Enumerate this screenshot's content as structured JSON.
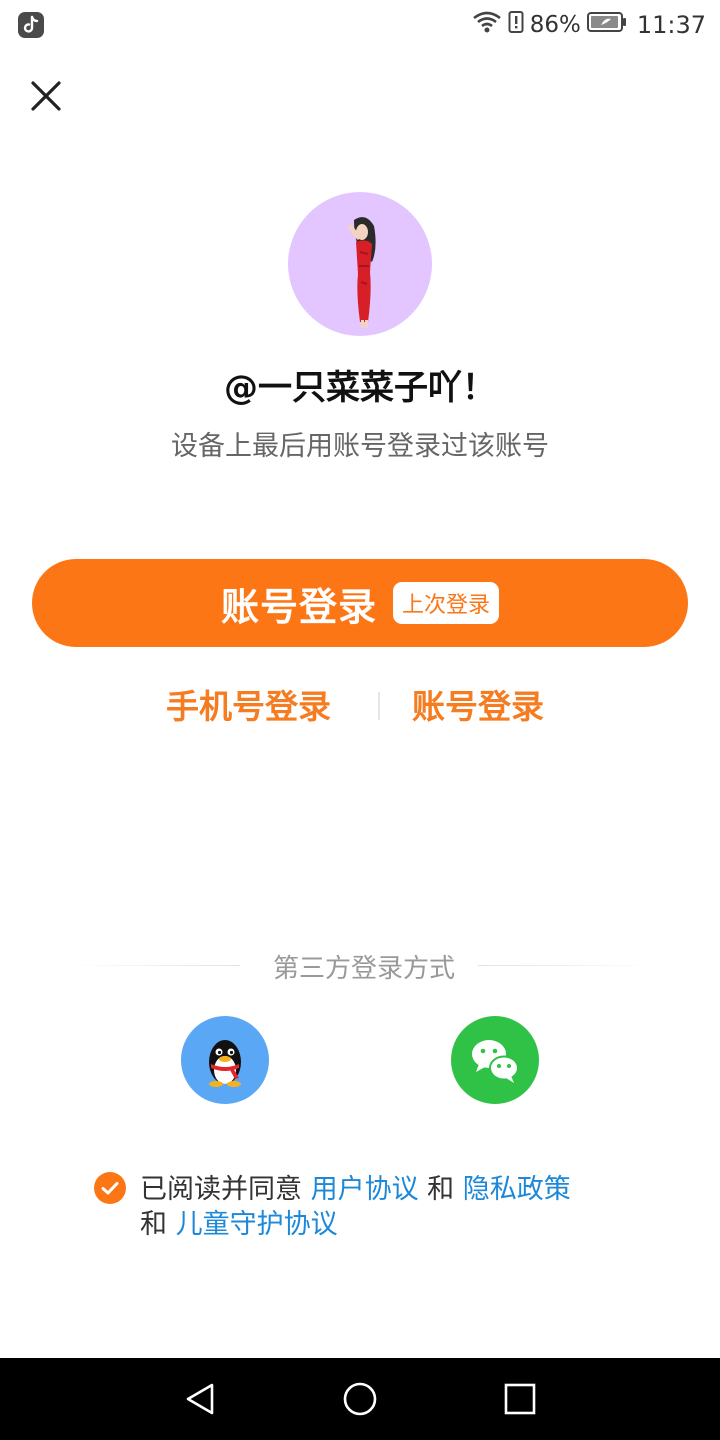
{
  "status_bar": {
    "battery_percent": "86%",
    "time": "11:37",
    "icons": [
      "tiktok-app-icon",
      "wifi-icon",
      "alert-icon",
      "battery-icon"
    ]
  },
  "profile": {
    "username": "@一只菜菜子吖！",
    "subtitle": "设备上最后用账号登录过该账号"
  },
  "primary_login": {
    "label": "账号登录",
    "badge": "上次登录",
    "color": "#fd7615"
  },
  "alt_login": {
    "phone_label": "手机号登录",
    "account_label": "账号登录",
    "color": "#f57c20"
  },
  "third_party": {
    "title": "第三方登录方式",
    "providers": [
      {
        "name": "qq",
        "icon": "qq-penguin-icon",
        "color": "#5aa7f5"
      },
      {
        "name": "wechat",
        "icon": "wechat-icon",
        "color": "#2fc246"
      }
    ]
  },
  "agreement": {
    "checked": true,
    "prefix": "已阅读并同意 ",
    "link_user": "用户协议",
    "and1": " 和 ",
    "link_privacy": "隐私政策",
    "and2": " 和 ",
    "link_children": "儿童守护协议",
    "link_color": "#1e88d8"
  },
  "nav_bar": {
    "icons": [
      "back-triangle-icon",
      "home-circle-icon",
      "recent-square-icon"
    ]
  }
}
